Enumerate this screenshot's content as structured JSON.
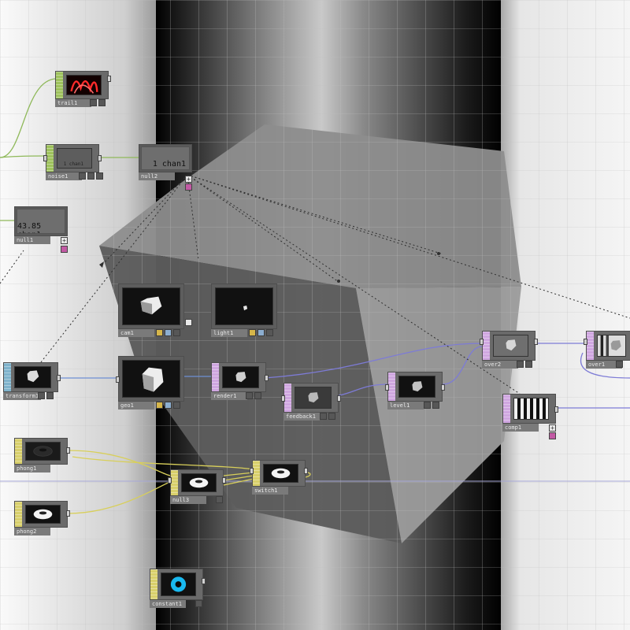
{
  "viewport": {
    "background": "#eaeaea",
    "panel_dark": "#000000"
  },
  "colors": {
    "wire_chop": "#8fb95a",
    "wire_top": "#7d7bd6",
    "wire_mat": "#d8cf5a",
    "wire_comp": "#6e8fd4",
    "wire_export": "#333333"
  },
  "nodes": {
    "trail1": {
      "name": "trail1"
    },
    "noise1": {
      "name": "noise1"
    },
    "chop1": {
      "name": "noise1",
      "value": "1 chan1"
    },
    "selected_chop": {
      "name": "null2",
      "value": "1 chan1"
    },
    "null1": {
      "name": "null1",
      "value": "43.85 chan1"
    },
    "cam1": {
      "name": "cam1"
    },
    "light1": {
      "name": "light1"
    },
    "geo1": {
      "name": "geo1"
    },
    "transform1": {
      "name": "transform1"
    },
    "render1": {
      "name": "render1"
    },
    "feedback1": {
      "name": "feedback1"
    },
    "level1": {
      "name": "level1"
    },
    "over2": {
      "name": "over2"
    },
    "over1": {
      "name": "over1"
    },
    "comp_right": {
      "name": "comp1"
    },
    "phong1": {
      "name": "phong1"
    },
    "phong2": {
      "name": "phong2"
    },
    "null3": {
      "name": "null3"
    },
    "switch1": {
      "name": "switch1"
    },
    "constant1": {
      "name": "constant1"
    }
  }
}
